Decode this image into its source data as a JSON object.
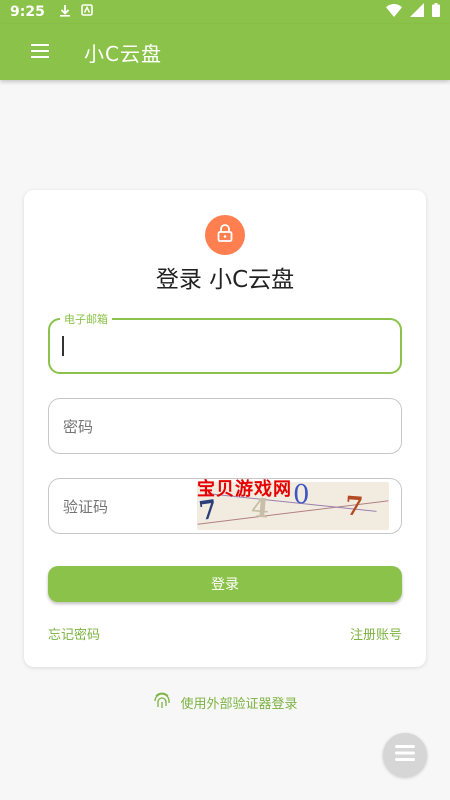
{
  "status_bar": {
    "time": "9:25",
    "left_icons": [
      "download-icon",
      "notification-icon"
    ],
    "right_icons": [
      "wifi-icon",
      "signal-icon",
      "battery-icon"
    ]
  },
  "app_bar": {
    "title": "小C云盘",
    "menu_icon": "menu-icon",
    "background_color": "#8bc34a"
  },
  "login": {
    "heading": "登录 小C云盘",
    "lock_icon": "lock-icon",
    "lock_color": "#ff7f50",
    "email": {
      "label": "电子邮箱",
      "value": ""
    },
    "password": {
      "placeholder": "密码",
      "value": ""
    },
    "captcha": {
      "placeholder": "验证码",
      "value": "",
      "image_text": "7407",
      "watermark": "宝贝游戏网"
    },
    "submit_label": "登录",
    "forgot_password": "忘记密码",
    "register": "注册账号"
  },
  "external_auth": {
    "icon": "fingerprint-icon",
    "label": "使用外部验证器登录"
  },
  "fab": {
    "icon": "menu-icon"
  }
}
